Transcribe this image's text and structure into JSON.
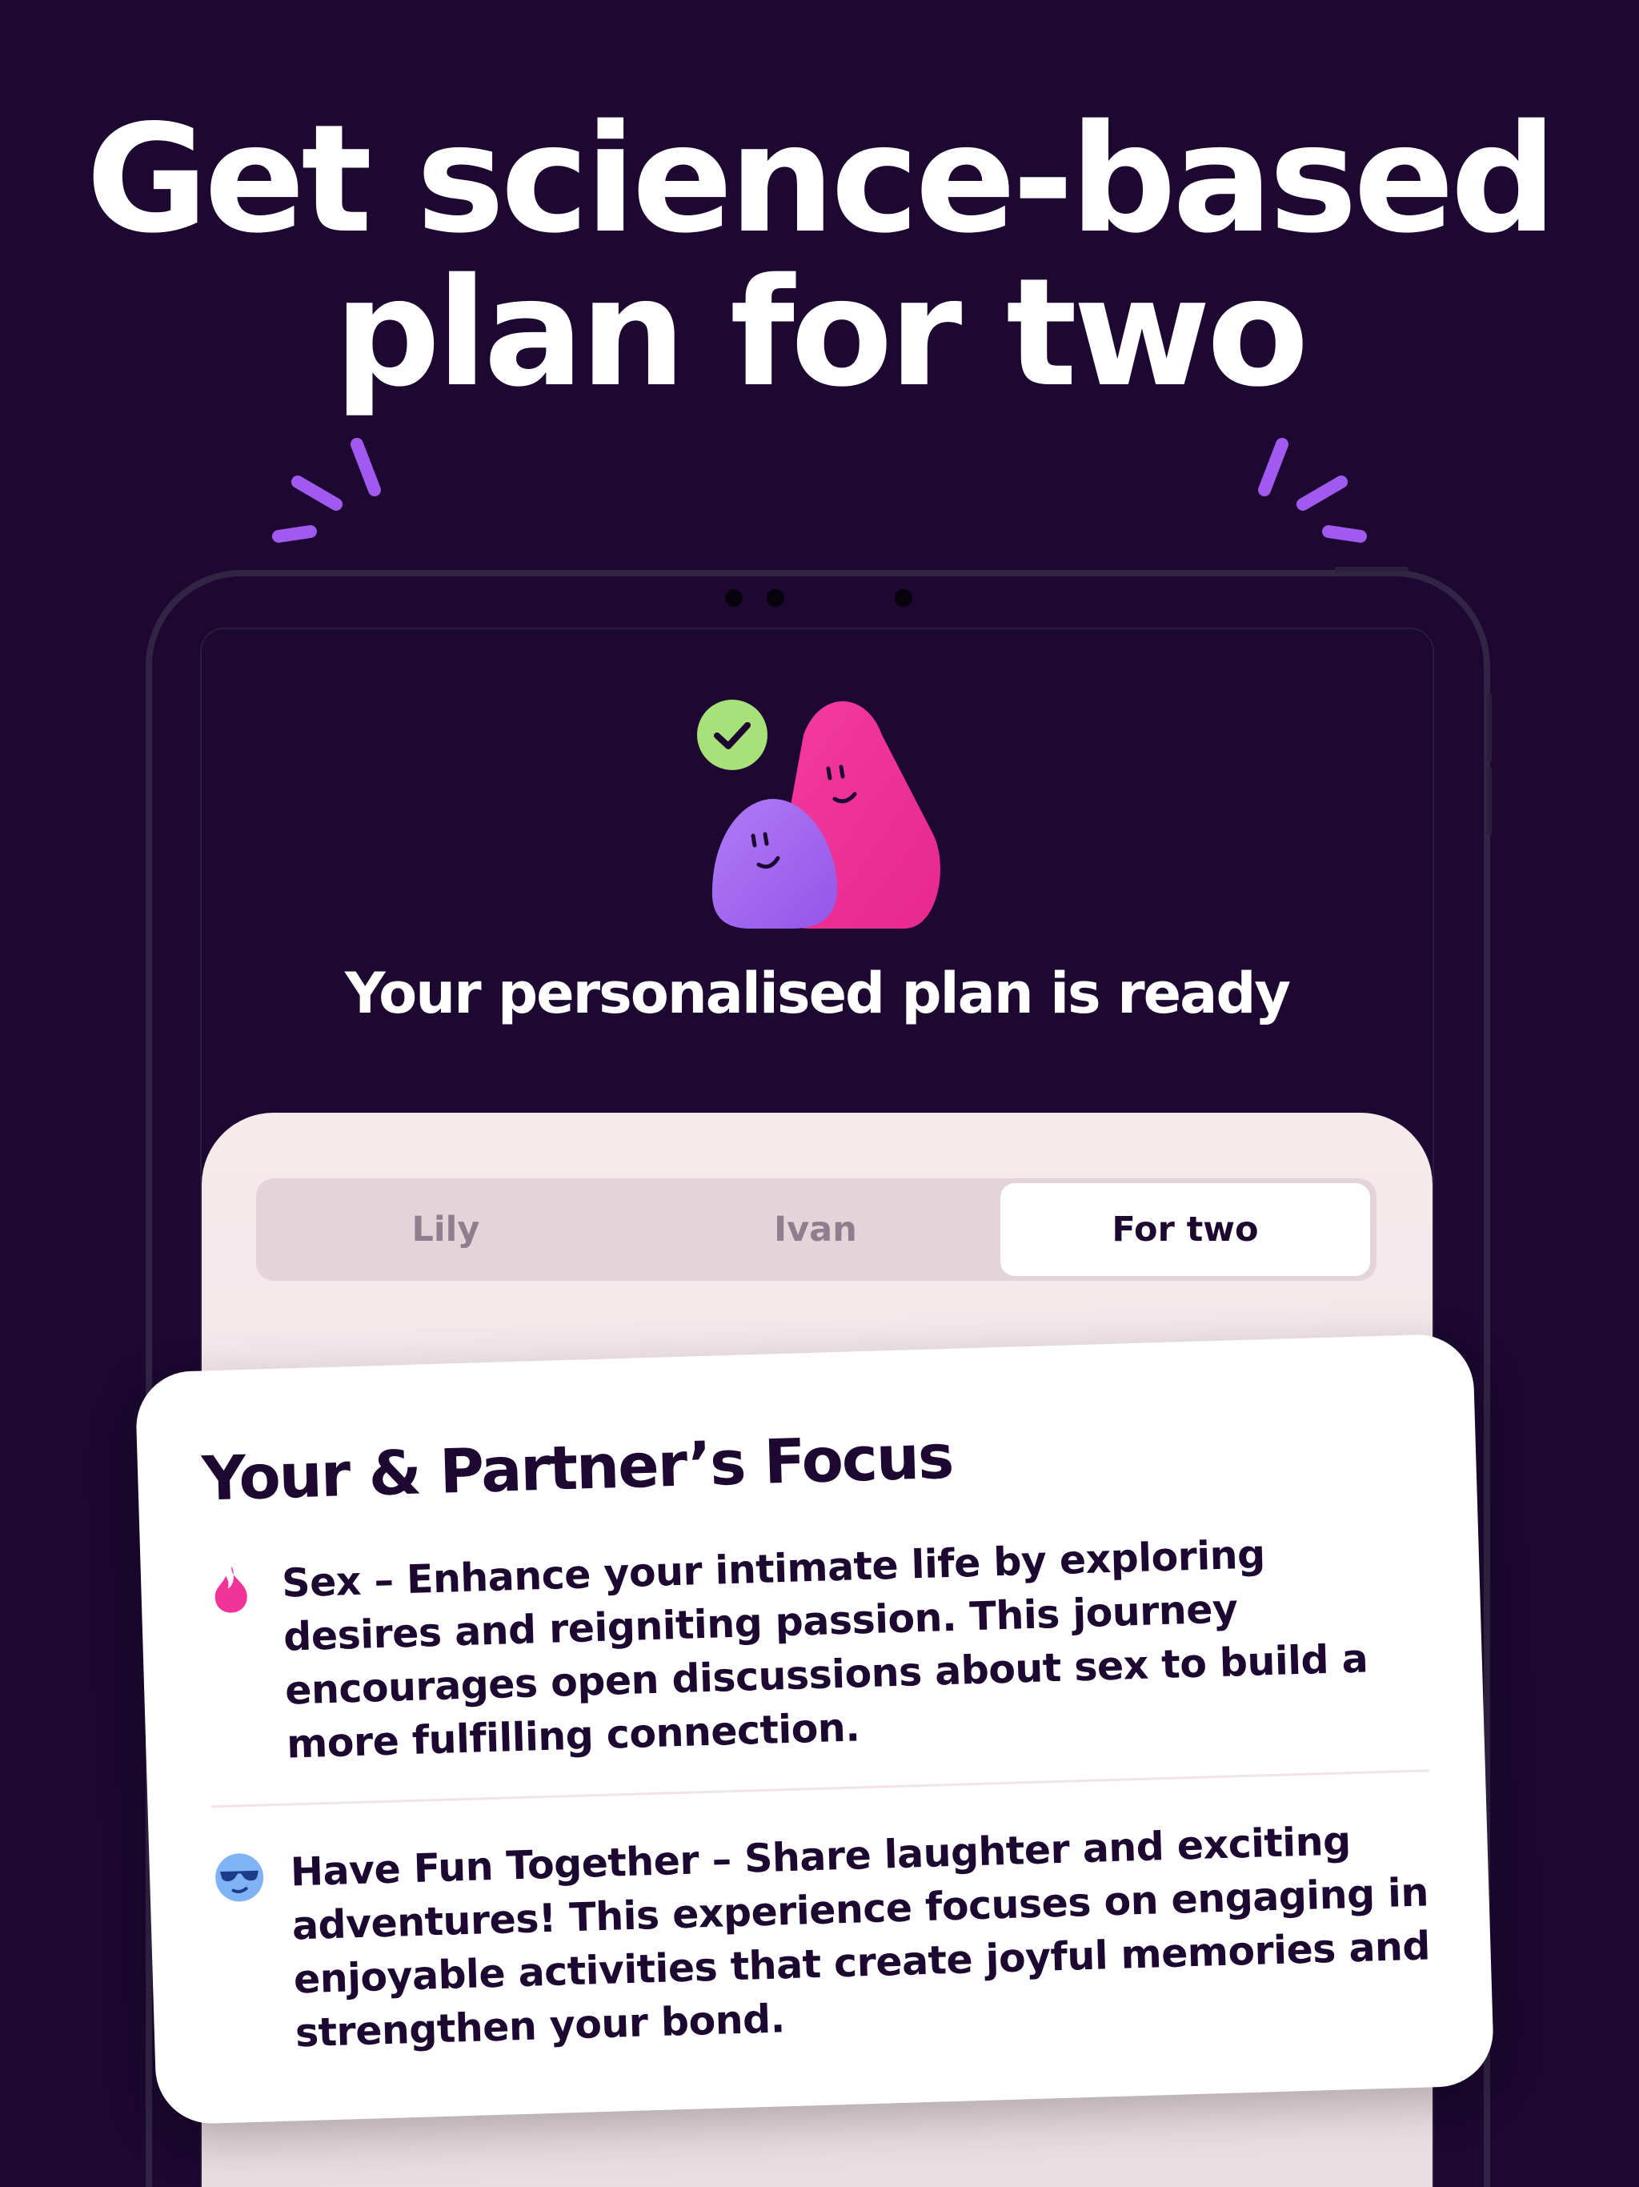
{
  "headline": {
    "line1": "Get science-based",
    "line2": "plan for two"
  },
  "screen": {
    "title": "Your personalised plan is ready",
    "tabs": [
      {
        "label": "Lily",
        "selected": false
      },
      {
        "label": "Ivan",
        "selected": false
      },
      {
        "label": "For two",
        "selected": true
      }
    ]
  },
  "focus_card": {
    "title": "Your & Partner’s Focus",
    "items": [
      {
        "icon": "flame-icon",
        "text": "Sex – Enhance your intimate life by exploring desires and reigniting passion. This journey encourages open discussions about sex to build a more fulfilling connection."
      },
      {
        "icon": "cool-face-icon",
        "text": "Have Fun Together – Share laughter and exciting adventures! This experience focuses on engaging in enjoyable activities that create joyful memories and strengthen your bond."
      }
    ]
  },
  "colors": {
    "background": "#1c0830",
    "accent_purple": "#a259ef",
    "accent_pink": "#f2349a",
    "check_green": "#a8e07a",
    "sheet": "#f6eaed",
    "text_dark": "#1c0830"
  }
}
